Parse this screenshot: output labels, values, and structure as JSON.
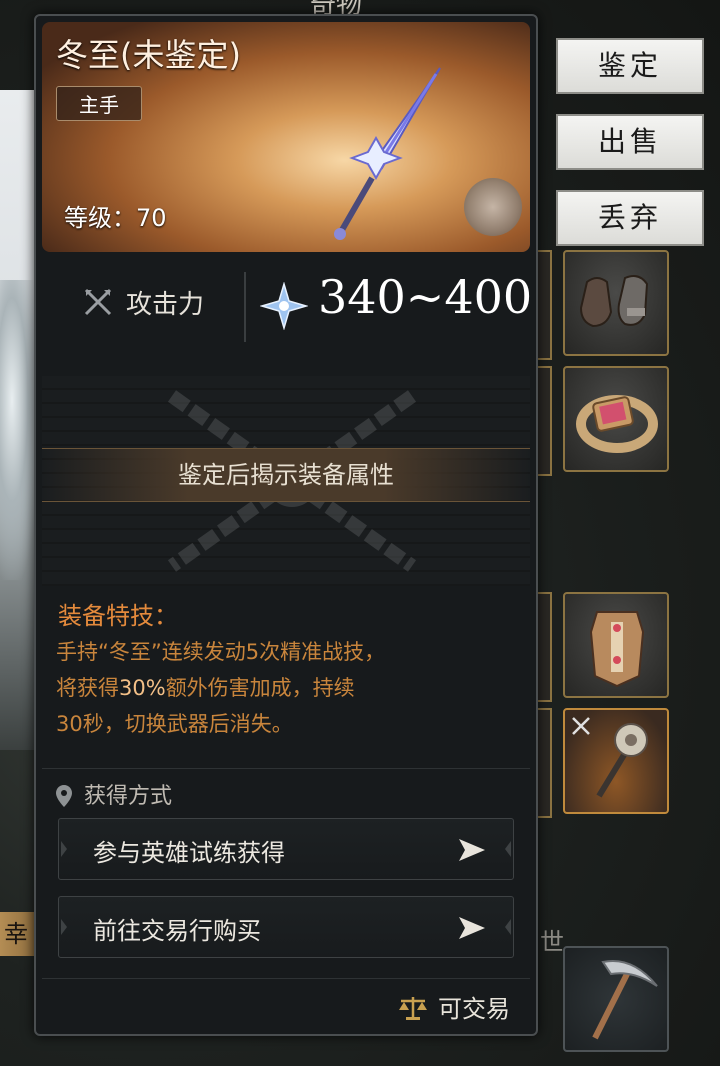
{
  "screen_title": "奇物",
  "side_actions": [
    {
      "label": "鉴定"
    },
    {
      "label": "出售"
    },
    {
      "label": "丢弃"
    }
  ],
  "background_labels": {
    "left": "幸",
    "right": "世"
  },
  "tooltip": {
    "item_name": "冬至(未鉴定)",
    "slot_type": "主手",
    "level_text": "等级：70",
    "stat": {
      "label": "攻击力",
      "value": "340~400"
    },
    "hidden_prompt": "鉴定后揭示装备属性",
    "skill": {
      "title": "装备特技：",
      "line1": "手持“冬至”连续发动5次精准战技，",
      "line2_pre": "将获得",
      "line2_hl": "30%",
      "line2_post": "额外伤害加成，持续",
      "line3": "30秒，切换武器后消失。"
    },
    "obtain": {
      "title": "获得方式",
      "routes": [
        {
          "label": "参与英雄试练获得"
        },
        {
          "label": "前往交易行购买"
        }
      ]
    },
    "tradable_text": "可交易"
  },
  "colors": {
    "skill": "#c9853c",
    "skill_title": "#e48a3c",
    "highlight": "#f3c088",
    "slot_border": "#8c7442"
  },
  "icons": [
    "attack-swords-icon",
    "ice-star-icon",
    "rarity-emblem-icon",
    "location-pin-icon",
    "arrow-right-icon",
    "scale-icon"
  ]
}
